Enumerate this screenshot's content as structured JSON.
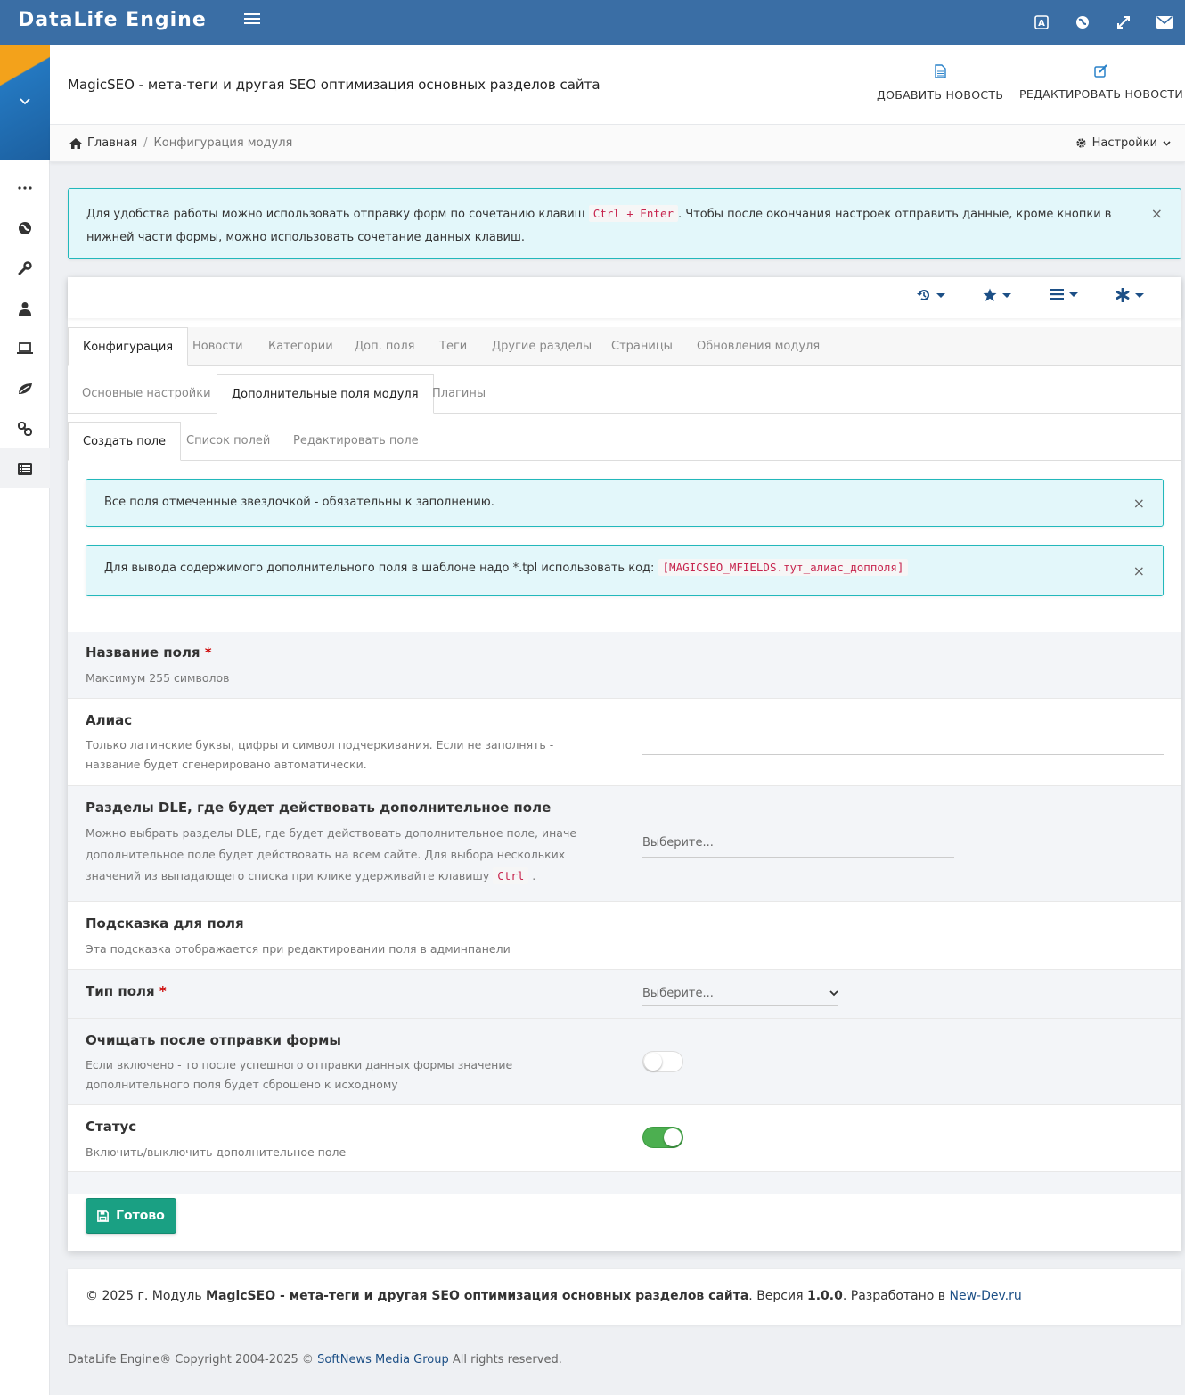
{
  "topbar": {
    "brand": "DataLife Engine",
    "icons": [
      "translate-icon",
      "globe-icon",
      "fullscreen-icon",
      "envelope-icon"
    ]
  },
  "sidebar": {
    "items": [
      "more-icon",
      "globe-icon",
      "wrench-icon",
      "user-icon",
      "laptop-icon",
      "leaf-icon",
      "link-icon",
      "list-icon"
    ]
  },
  "header": {
    "title": "MagicSEO - мета-теги и другая SEO оптимизация основных разделов сайта",
    "add_news": "ДОБАВИТЬ НОВОСТЬ",
    "edit_news": "РЕДАКТИРОВАТЬ НОВОСТИ"
  },
  "breadcrumb": {
    "home": "Главная",
    "separator": "/",
    "current": "Конфигурация модуля",
    "settings": "Настройки"
  },
  "alert_main": {
    "text_before": "Для удобства работы можно использовать отправку форм по сочетанию клавиш",
    "code": "Ctrl + Enter",
    "text_after": ". Чтобы после окончания настроек отправить данные, кроме кнопки в нижней части формы, можно использовать сочетание данных клавиш.",
    "close": "×"
  },
  "tabs_level1": [
    "Конфигурация",
    "Новости",
    "Категории",
    "Доп. поля",
    "Теги",
    "Другие разделы",
    "Страницы",
    "Обновления модуля"
  ],
  "tabs_level2": [
    "Основные настройки",
    "Дополнительные поля модуля",
    "Плагины"
  ],
  "tabs_level3": [
    "Создать поле",
    "Список полей",
    "Редактировать поле"
  ],
  "alert_required": {
    "text": "Все поля отмеченные звездочкой - обязательны к заполнению.",
    "close": "×"
  },
  "alert_tpl": {
    "text": "Для вывода содержимого дополнительного поля в шаблоне надо *.tpl использовать код:",
    "code": "[MAGICSEO_MFIELDS.тут_алиас_допполя]",
    "close": "×"
  },
  "form": {
    "name": {
      "label": "Название поля",
      "required": "*",
      "hint": "Максимум 255 символов"
    },
    "alias": {
      "label": "Алиас",
      "hint": "Только латинские буквы, цифры и символ подчеркивания. Если не заполнять - название будет сгенерировано автоматически."
    },
    "sections": {
      "label": "Разделы DLE, где будет действовать дополнительное поле",
      "hint": "Можно выбрать разделы DLE, где будет действовать дополнительное поле, иначе дополнительное поле будет действовать на всем сайте. Для выбора нескольких значений из выпадающего списка при клике удерживайте клавишу",
      "hint_code": "Ctrl",
      "hint_end": ".",
      "placeholder": "Выберите..."
    },
    "tooltip": {
      "label": "Подсказка для поля",
      "hint": "Эта подсказка отображается при редактировании поля в админпанели"
    },
    "type": {
      "label": "Тип поля",
      "required": "*",
      "selected": "Выберите..."
    },
    "clear": {
      "label": "Очищать после отправки формы",
      "hint": "Если включено - то после успешного отправки данных формы значение дополнительного поля будет сброшено к исходному",
      "enabled": false
    },
    "status": {
      "label": "Статус",
      "hint": "Включить/выключить дополнительное поле",
      "enabled": true
    }
  },
  "done_button": "Готово",
  "footer": {
    "prefix": "© 2025 г. Модуль",
    "module": "MagicSEO - мета-теги и другая SEO оптимизация основных разделов сайта",
    "version_label": ". Версия",
    "version": "1.0.0",
    "dev_label": ". Разработано в",
    "dev_link": "New-Dev.ru"
  },
  "copyright": {
    "prefix": "DataLife Engine® Copyright 2004-2025 ©",
    "link": "SoftNews Media Group",
    "suffix": "All rights reserved."
  },
  "colors": {
    "topbar": "#3a6ea5",
    "accent": "#1c4f86",
    "done": "#1aa083",
    "toggle_on": "#4caf50",
    "alert_border": "#22b8bb"
  }
}
